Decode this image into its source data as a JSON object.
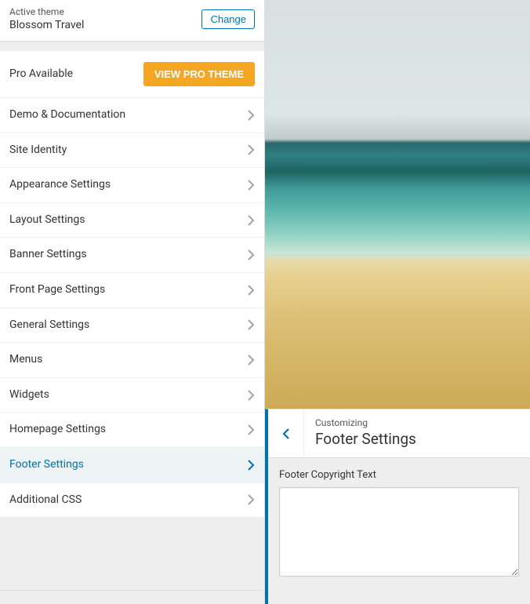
{
  "theme": {
    "active_label": "Active theme",
    "name": "Blossom Travel",
    "change_label": "Change"
  },
  "pro": {
    "text": "Pro Available",
    "button": "VIEW PRO THEME"
  },
  "nav": [
    {
      "label": "Demo & Documentation",
      "selected": false
    },
    {
      "label": "Site Identity",
      "selected": false
    },
    {
      "label": "Appearance Settings",
      "selected": false
    },
    {
      "label": "Layout Settings",
      "selected": false
    },
    {
      "label": "Banner Settings",
      "selected": false
    },
    {
      "label": "Front Page Settings",
      "selected": false
    },
    {
      "label": "General Settings",
      "selected": false
    },
    {
      "label": "Menus",
      "selected": false
    },
    {
      "label": "Widgets",
      "selected": false
    },
    {
      "label": "Homepage Settings",
      "selected": false
    },
    {
      "label": "Footer Settings",
      "selected": true
    },
    {
      "label": "Additional CSS",
      "selected": false
    }
  ],
  "subpanel": {
    "crumb": "Customizing",
    "title": "Footer Settings",
    "field_label": "Footer Copyright Text",
    "field_value": ""
  },
  "colors": {
    "accent": "#0073aa",
    "pro_button": "#f5a623"
  }
}
